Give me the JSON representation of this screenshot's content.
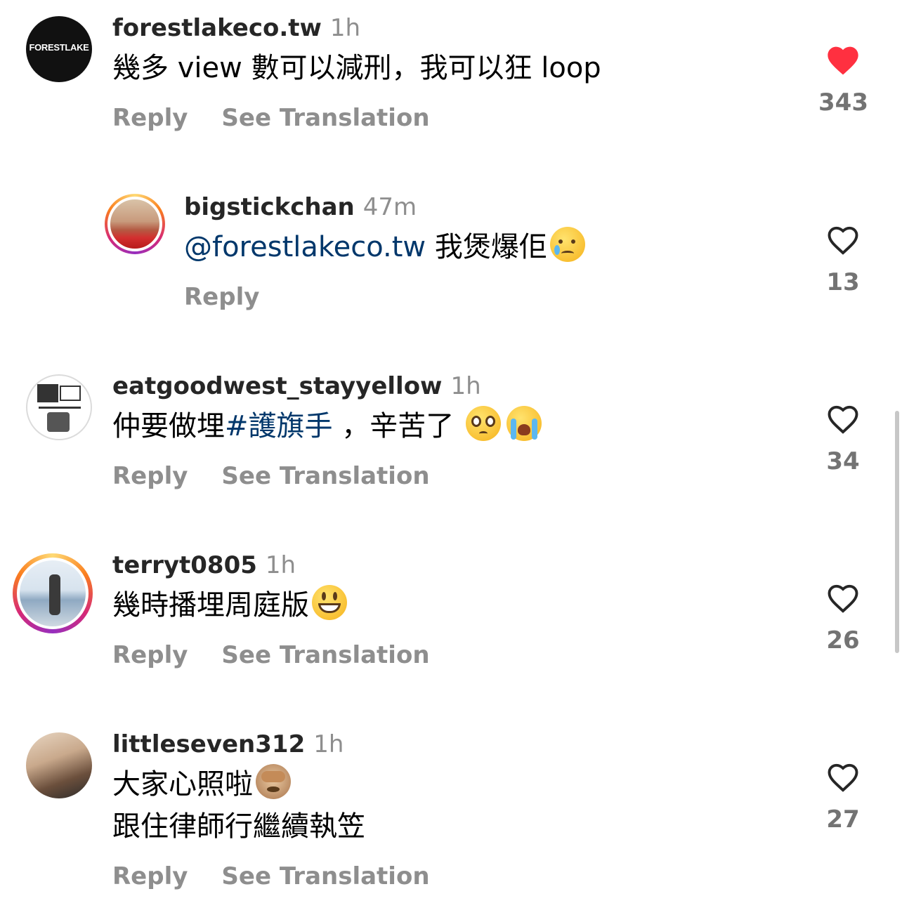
{
  "comments": [
    {
      "username": "forestlakeco.tw",
      "time": "1h",
      "avatar_text": "FORESTLAKE",
      "text": "幾多 view 數可以減刑，我可以狂 loop",
      "actions": [
        "Reply",
        "See Translation"
      ],
      "likes": "343",
      "liked": true
    },
    {
      "username": "bigstickchan",
      "time": "47m",
      "mention": "@forestlakeco.tw",
      "text": "我煲爆佢",
      "emoji": "crying-face",
      "actions": [
        "Reply"
      ],
      "likes": "13",
      "liked": false
    },
    {
      "username": "eatgoodwest_stayyellow",
      "time": "1h",
      "text_before": "仲要做埋",
      "hashtag": "#護旗手",
      "text_after": " ，辛苦了",
      "emojis": [
        "pleading-face",
        "loudly-crying-face"
      ],
      "actions": [
        "Reply",
        "See Translation"
      ],
      "likes": "34",
      "liked": false
    },
    {
      "username": "terryt0805",
      "time": "1h",
      "text": "幾時播埋周庭版",
      "emoji": "grinning-face",
      "actions": [
        "Reply",
        "See Translation"
      ],
      "likes": "26",
      "liked": false
    },
    {
      "username": "littleseven312",
      "time": "1h",
      "text_line1": "大家心照啦",
      "text_line2": "跟住律師行繼續執笠",
      "emoji": "see-no-evil-monkey",
      "actions": [
        "Reply",
        "See Translation"
      ],
      "likes": "27",
      "liked": false
    }
  ],
  "colors": {
    "like_red": "#ff3040",
    "link_blue": "#00376b",
    "muted": "#8e8e8e"
  }
}
